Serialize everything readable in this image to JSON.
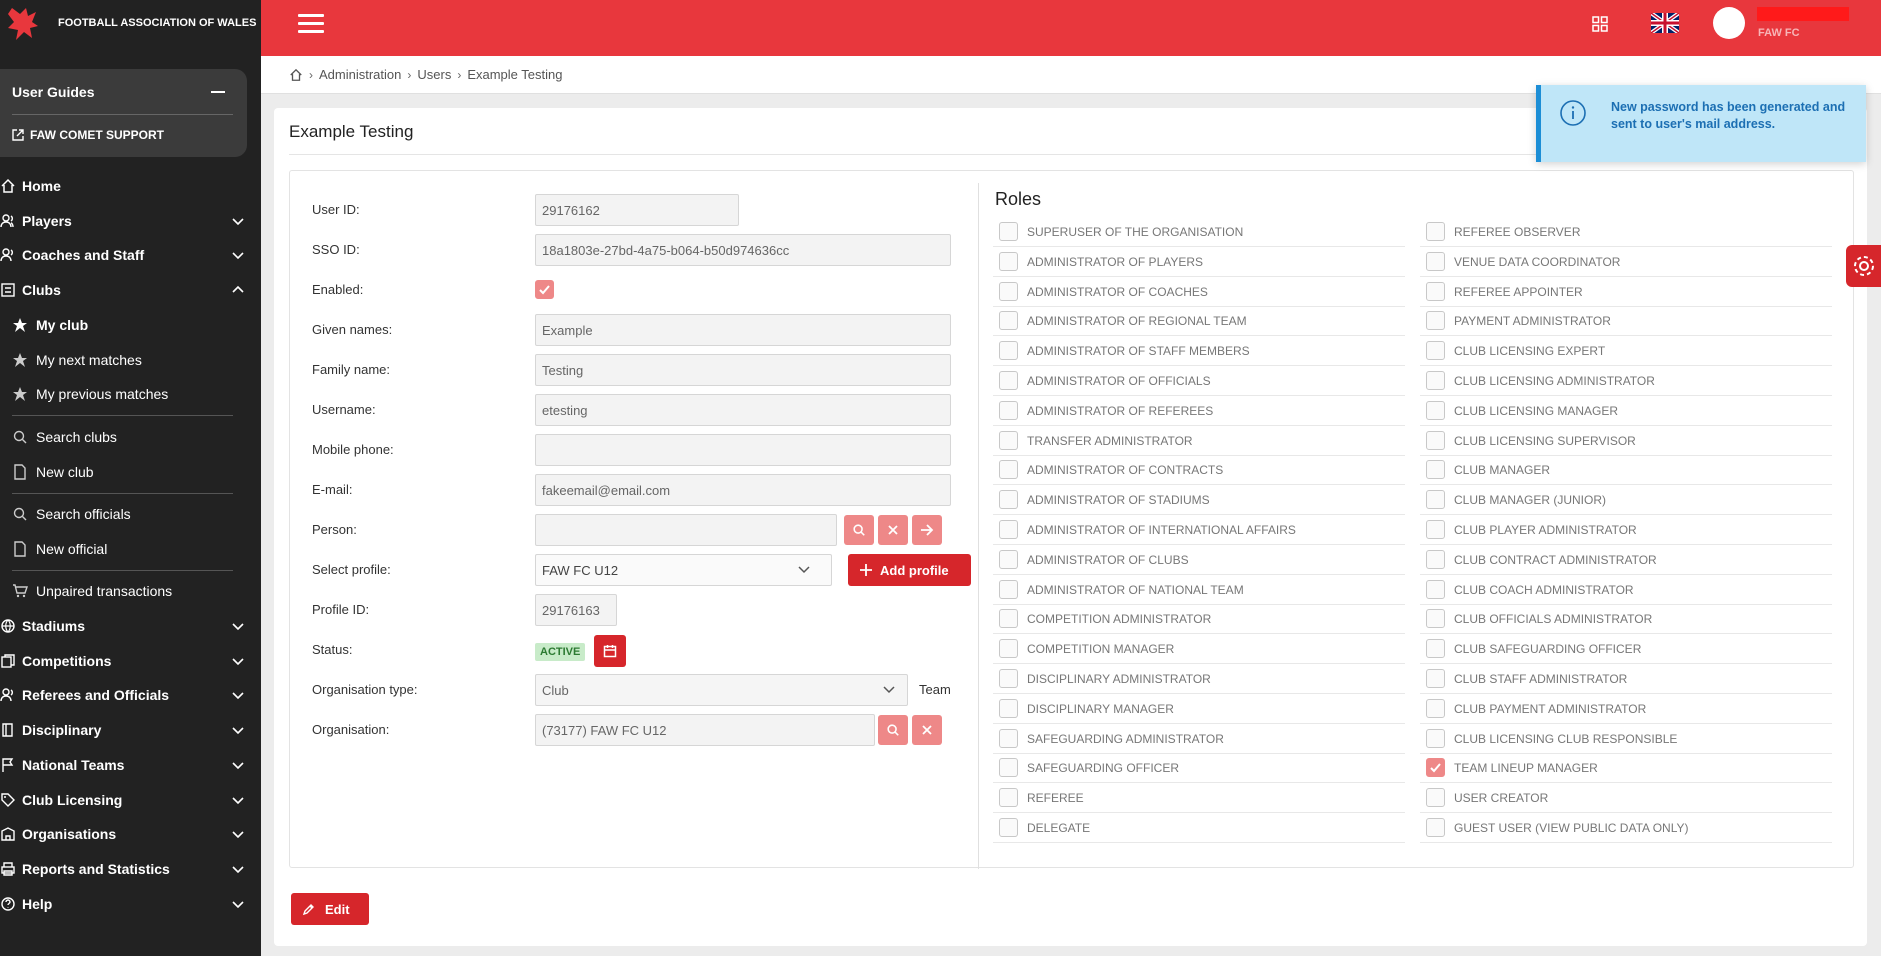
{
  "brand": {
    "org_name": "FOOTBALL ASSOCIATION OF WALES",
    "accent": "#e8373d"
  },
  "topbar": {
    "club": "FAW FC"
  },
  "guides": {
    "title": "User Guides",
    "support": "FAW COMET SUPPORT"
  },
  "nav": {
    "home": "Home",
    "players": "Players",
    "coaches": "Coaches and Staff",
    "clubs": "Clubs",
    "my_club": "My club",
    "next_matches": "My next matches",
    "prev_matches": "My previous matches",
    "search_clubs": "Search clubs",
    "new_club": "New club",
    "search_officials": "Search officials",
    "new_official": "New official",
    "unpaired": "Unpaired transactions",
    "stadiums": "Stadiums",
    "competitions": "Competitions",
    "referees": "Referees and Officials",
    "disciplinary": "Disciplinary",
    "national": "National Teams",
    "licensing": "Club Licensing",
    "organisations": "Organisations",
    "reports": "Reports and Statistics",
    "help": "Help"
  },
  "breadcrumb": [
    "Administration",
    "Users",
    "Example Testing"
  ],
  "page": {
    "title": "Example Testing",
    "edit": "Edit"
  },
  "form": {
    "user_id_label": "User ID:",
    "user_id": "29176162",
    "sso_label": "SSO ID:",
    "sso": "18a1803e-27bd-4a75-b064-b50d974636cc",
    "enabled_label": "Enabled:",
    "enabled": true,
    "given_label": "Given names:",
    "given": "Example",
    "family_label": "Family name:",
    "family": "Testing",
    "username_label": "Username:",
    "username": "etesting",
    "mobile_label": "Mobile phone:",
    "mobile": "",
    "email_label": "E-mail:",
    "email": "fakeemail@email.com",
    "person_label": "Person:",
    "person": "",
    "profile_label": "Select profile:",
    "profile": "FAW FC U12",
    "add_profile": "Add profile",
    "profile_id_label": "Profile ID:",
    "profile_id": "29176163",
    "status_label": "Status:",
    "status": "ACTIVE",
    "org_type_label": "Organisation type:",
    "org_type": "Club",
    "team": "Team",
    "org_label": "Organisation:",
    "org": "(73177) FAW FC U12"
  },
  "roles": {
    "title": "Roles",
    "left": [
      {
        "label": "SUPERUSER OF THE ORGANISATION",
        "checked": false
      },
      {
        "label": "ADMINISTRATOR OF PLAYERS",
        "checked": false
      },
      {
        "label": "ADMINISTRATOR OF COACHES",
        "checked": false
      },
      {
        "label": "ADMINISTRATOR OF REGIONAL TEAM",
        "checked": false
      },
      {
        "label": "ADMINISTRATOR OF STAFF MEMBERS",
        "checked": false
      },
      {
        "label": "ADMINISTRATOR OF OFFICIALS",
        "checked": false
      },
      {
        "label": "ADMINISTRATOR OF REFEREES",
        "checked": false
      },
      {
        "label": "TRANSFER ADMINISTRATOR",
        "checked": false
      },
      {
        "label": "ADMINISTRATOR OF CONTRACTS",
        "checked": false
      },
      {
        "label": "ADMINISTRATOR OF STADIUMS",
        "checked": false
      },
      {
        "label": "ADMINISTRATOR OF INTERNATIONAL AFFAIRS",
        "checked": false
      },
      {
        "label": "ADMINISTRATOR OF CLUBS",
        "checked": false
      },
      {
        "label": "ADMINISTRATOR OF NATIONAL TEAM",
        "checked": false
      },
      {
        "label": "COMPETITION ADMINISTRATOR",
        "checked": false
      },
      {
        "label": "COMPETITION MANAGER",
        "checked": false
      },
      {
        "label": "DISCIPLINARY ADMINISTRATOR",
        "checked": false
      },
      {
        "label": "DISCIPLINARY MANAGER",
        "checked": false
      },
      {
        "label": "SAFEGUARDING ADMINISTRATOR",
        "checked": false
      },
      {
        "label": "SAFEGUARDING OFFICER",
        "checked": false
      },
      {
        "label": "REFEREE",
        "checked": false
      },
      {
        "label": "DELEGATE",
        "checked": false
      }
    ],
    "right": [
      {
        "label": "REFEREE OBSERVER",
        "checked": false
      },
      {
        "label": "VENUE DATA COORDINATOR",
        "checked": false
      },
      {
        "label": "REFEREE APPOINTER",
        "checked": false
      },
      {
        "label": "PAYMENT ADMINISTRATOR",
        "checked": false
      },
      {
        "label": "CLUB LICENSING EXPERT",
        "checked": false
      },
      {
        "label": "CLUB LICENSING ADMINISTRATOR",
        "checked": false
      },
      {
        "label": "CLUB LICENSING MANAGER",
        "checked": false
      },
      {
        "label": "CLUB LICENSING SUPERVISOR",
        "checked": false
      },
      {
        "label": "CLUB MANAGER",
        "checked": false
      },
      {
        "label": "CLUB MANAGER (JUNIOR)",
        "checked": false
      },
      {
        "label": "CLUB PLAYER ADMINISTRATOR",
        "checked": false
      },
      {
        "label": "CLUB CONTRACT ADMINISTRATOR",
        "checked": false
      },
      {
        "label": "CLUB COACH ADMINISTRATOR",
        "checked": false
      },
      {
        "label": "CLUB OFFICIALS ADMINISTRATOR",
        "checked": false
      },
      {
        "label": "CLUB SAFEGUARDING OFFICER",
        "checked": false
      },
      {
        "label": "CLUB STAFF ADMINISTRATOR",
        "checked": false
      },
      {
        "label": "CLUB PAYMENT ADMINISTRATOR",
        "checked": false
      },
      {
        "label": "CLUB LICENSING CLUB RESPONSIBLE",
        "checked": false
      },
      {
        "label": "TEAM LINEUP MANAGER",
        "checked": true
      },
      {
        "label": "USER CREATOR",
        "checked": false
      },
      {
        "label": "GUEST USER (VIEW PUBLIC DATA ONLY)",
        "checked": false
      }
    ]
  },
  "toast": {
    "message": "New password has been generated and sent to user's mail address."
  }
}
